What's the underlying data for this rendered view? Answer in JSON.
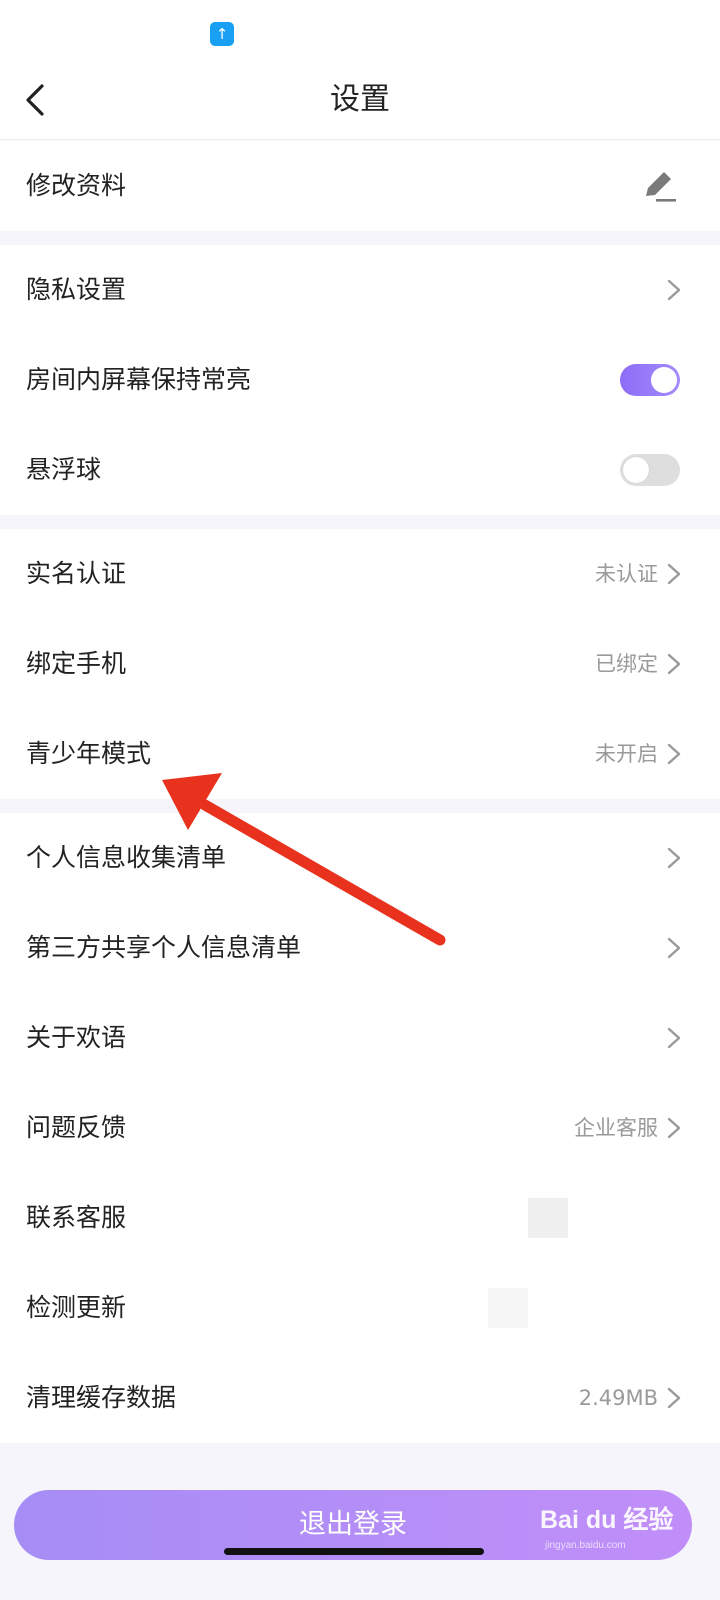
{
  "header": {
    "title": "设置",
    "back_icon": "chevron-left-icon"
  },
  "status_bar": {
    "icon": "upload-arrow-icon",
    "glyph": "↑"
  },
  "profile": {
    "edit_label": "修改资料",
    "icon": "pencil-edit-icon"
  },
  "settings_group_1": {
    "privacy_label": "隐私设置",
    "screen_on_label": "房间内屏幕保持常亮",
    "screen_on_enabled": true,
    "floating_ball_label": "悬浮球",
    "floating_ball_enabled": false
  },
  "settings_group_2": {
    "realname_label": "实名认证",
    "realname_value": "未认证",
    "phone_label": "绑定手机",
    "phone_value": "已绑定",
    "teen_label": "青少年模式",
    "teen_value": "未开启"
  },
  "settings_group_3": {
    "personal_info_label": "个人信息收集清单",
    "third_party_label": "第三方共享个人信息清单",
    "about_label": "关于欢语",
    "feedback_label": "问题反馈",
    "feedback_value": "企业客服",
    "contact_label": "联系客服",
    "update_label": "检测更新",
    "cache_label": "清理缓存数据",
    "cache_value": "2.49MB"
  },
  "logout": {
    "label": "退出登录"
  },
  "watermark": {
    "text": "Bai du 经验",
    "sub": "jingyan.baidu.com"
  },
  "colors": {
    "accent": "#8c6cf7",
    "logout_start": "#a68df6",
    "logout_end": "#c18ef8",
    "annotation_arrow": "#e8321e",
    "page_bg": "#f5f5fb"
  }
}
